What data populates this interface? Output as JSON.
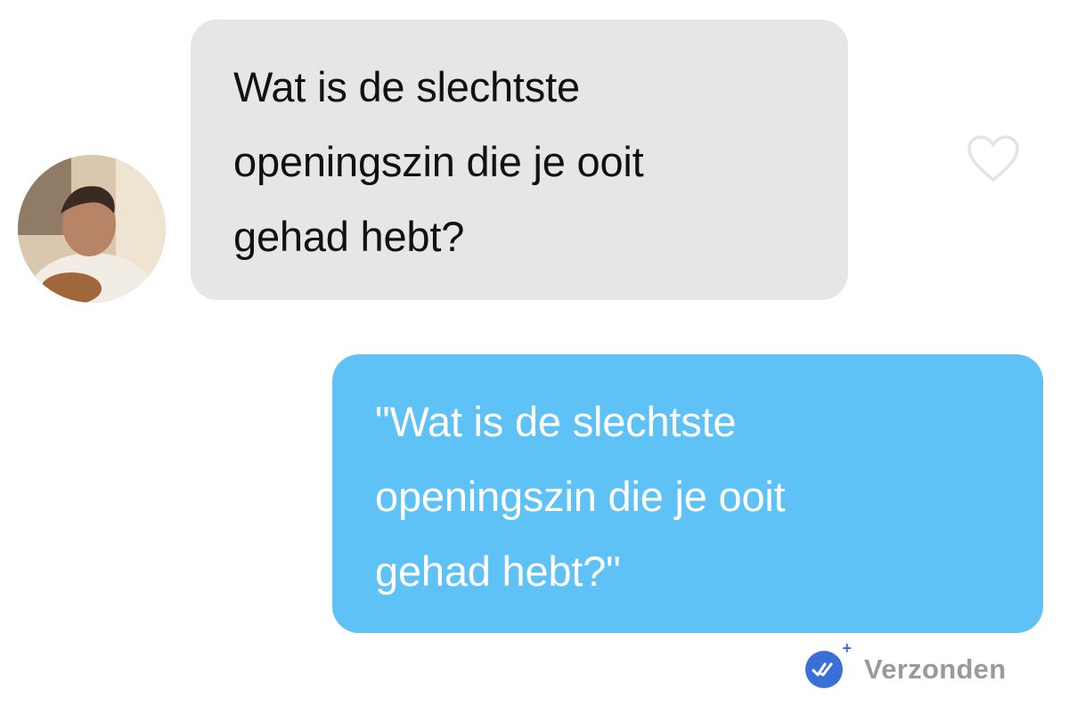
{
  "conversation": {
    "incoming_message": {
      "lines": [
        "Wat is de slechtste",
        "openingszin die je ooit",
        "gehad hebt?"
      ],
      "bubble_color": "#e6e6e6",
      "avatar_icon": "profile-photo"
    },
    "outgoing_message": {
      "lines": [
        "\"Wat is de slechtste",
        "openingszin die je ooit",
        "gehad hebt?\""
      ],
      "bubble_color": "#5ec2f7",
      "status_text": "Verzonden",
      "status_icon": "double-check-icon"
    },
    "like_icon": "heart-outline-icon"
  }
}
